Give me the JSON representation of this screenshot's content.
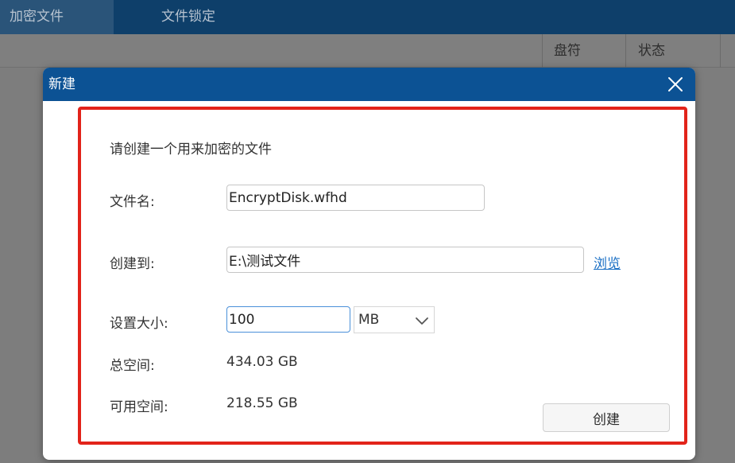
{
  "app": {
    "tabs": [
      {
        "label": "加密文件"
      },
      {
        "label": "文件锁定"
      }
    ],
    "columns": [
      "盘符",
      "状态"
    ]
  },
  "dialog": {
    "title": "新建",
    "intro": "请创建一个用来加密的文件",
    "file_name": {
      "label": "文件名:",
      "value": "EncryptDisk.wfhd"
    },
    "destination": {
      "label": "创建到:",
      "value": "E:\\测试文件",
      "browse_label": "浏览"
    },
    "size": {
      "label": "设置大小:",
      "value": "100",
      "unit": "MB"
    },
    "total_space": {
      "label": "总空间:",
      "value": "434.03 GB"
    },
    "available_space": {
      "label": "可用空间:",
      "value": "218.55 GB"
    },
    "create_button": "创建",
    "highlight_color": "#e2231a",
    "title_bar_color": "#0c5294"
  }
}
